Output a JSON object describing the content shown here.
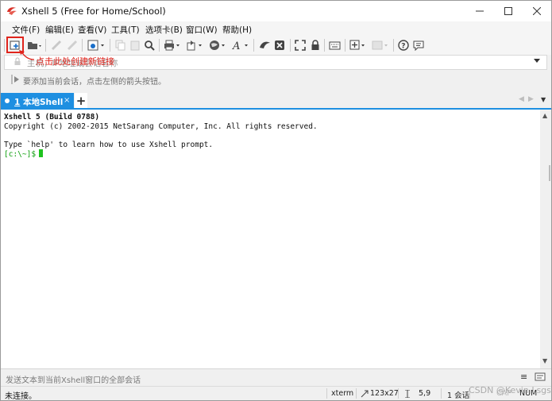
{
  "window": {
    "title": "Xshell 5 (Free for Home/School)",
    "controls": {
      "minimize": "─",
      "maximize": "☐",
      "close": "✕"
    }
  },
  "menu": [
    "文件(F)",
    "编辑(E)",
    "查看(V)",
    "工具(T)",
    "选项卡(B)",
    "窗口(W)",
    "帮助(H)"
  ],
  "toolbar": {
    "icons": [
      "new-session-icon",
      "open-folder-icon",
      "reconnect-icon",
      "disconnect-icon",
      "properties-icon",
      "copy-icon",
      "paste-icon",
      "find-icon",
      "print-icon",
      "transfer-icon",
      "globe-icon",
      "font-icon",
      "xftp-icon",
      "xmanager-icon",
      "fullscreen-icon",
      "lock-icon",
      "keyboard-icon",
      "new-tab-icon",
      "layout-icon",
      "help-icon",
      "chat-icon"
    ],
    "accent_highlight": "#e0241c"
  },
  "address": {
    "placeholder": "主机，IP地址或会话名称",
    "annotation": "点击此处创建新链接"
  },
  "linkbar": {
    "text": "要添加当前会话，点击左侧的箭头按钮。"
  },
  "tabs": {
    "active": {
      "number": "1",
      "label": "本地Shell",
      "close": "×"
    },
    "add": "+",
    "nav_prev": "◀",
    "nav_next": "▶",
    "menu": "▼",
    "color": "#1e8fe1"
  },
  "terminal": {
    "lines": [
      "Xshell 5 (Build 0788)",
      "Copyright (c) 2002-2015 NetSarang Computer, Inc. All rights reserved.",
      "",
      "Type `help' to learn how to use Xshell prompt."
    ],
    "prompt": "[c:\\~]$"
  },
  "compose": {
    "placeholder": "发送文本到当前Xshell窗口的全部会话",
    "menu": "≡"
  },
  "status": {
    "connection": "未连接。",
    "term": "xterm",
    "size": "123x27",
    "cursor": "5,9",
    "sessions": "1 会话",
    "caps": "CAP",
    "num": "NUM"
  },
  "watermark": "CSDN @Kevin Lsgs"
}
